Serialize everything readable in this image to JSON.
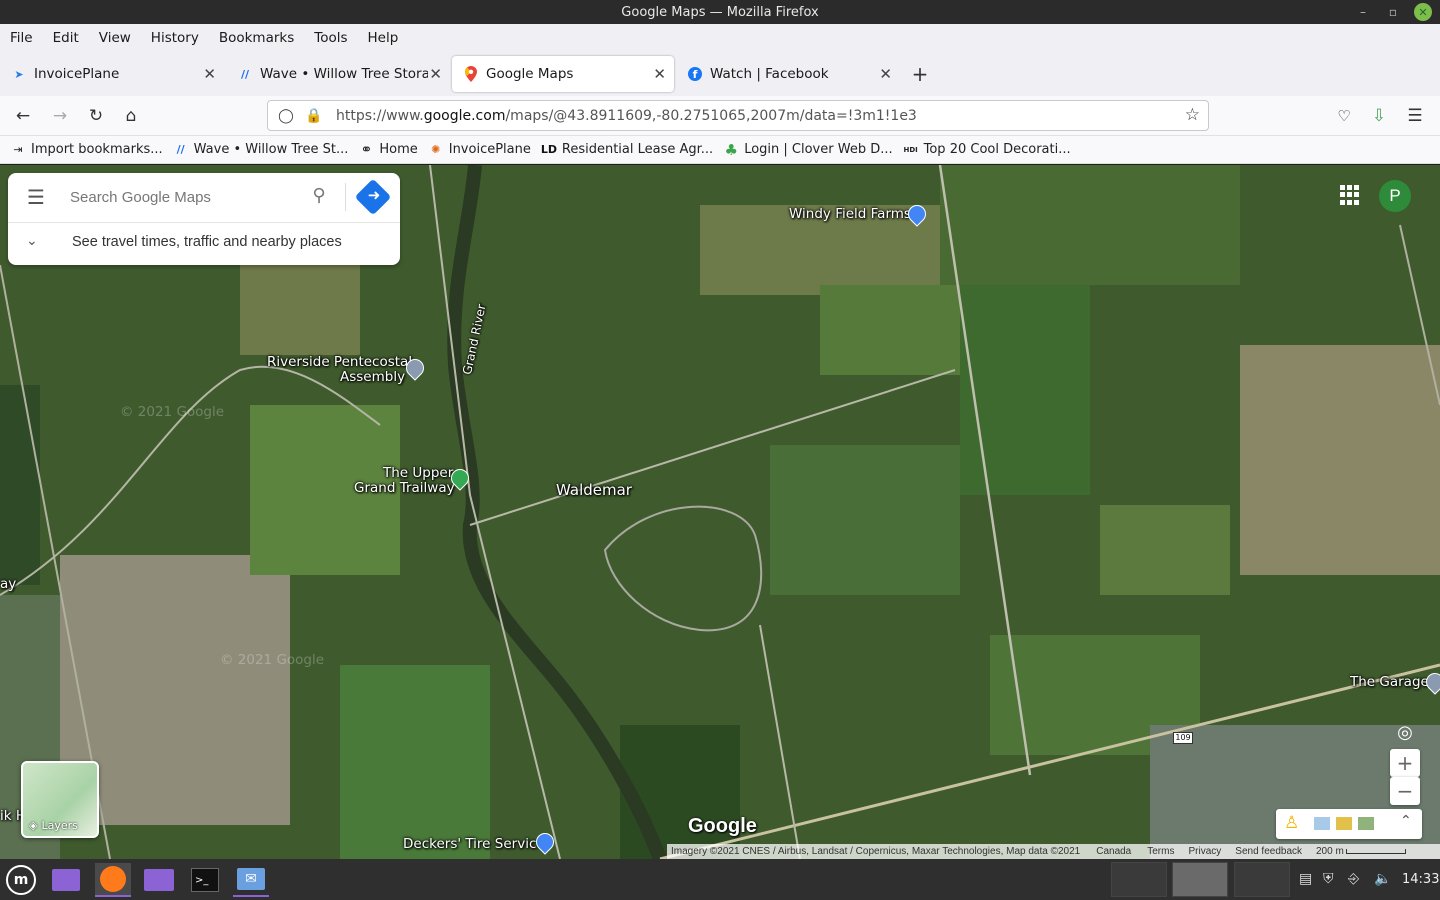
{
  "window": {
    "title": "Google Maps — Mozilla Firefox"
  },
  "menu": [
    "File",
    "Edit",
    "View",
    "History",
    "Bookmarks",
    "Tools",
    "Help"
  ],
  "tabs": [
    {
      "label": "InvoicePlane",
      "icon": "invoiceplane-icon"
    },
    {
      "label": "Wave • Willow Tree Storage",
      "icon": "wave-icon"
    },
    {
      "label": "Google Maps",
      "icon": "google-maps-icon",
      "active": true
    },
    {
      "label": "Watch | Facebook",
      "icon": "facebook-icon"
    }
  ],
  "url": {
    "scheme": "https://www.",
    "domain": "google.com",
    "path": "/maps/@43.8911609,-80.2751065,2007m/data=!3m1!1e3"
  },
  "bookmarks": [
    {
      "label": "Import bookmarks...",
      "icon": "import-icon"
    },
    {
      "label": "Wave • Willow Tree St...",
      "icon": "wave-icon"
    },
    {
      "label": "Home",
      "icon": "globe-icon"
    },
    {
      "label": "InvoicePlane",
      "icon": "invoiceplane-icon"
    },
    {
      "label": "Residential Lease Agr...",
      "icon": "ld-icon"
    },
    {
      "label": "Login | Clover Web D...",
      "icon": "clover-icon"
    },
    {
      "label": "Top 20 Cool Decorati...",
      "icon": "hdi-icon"
    }
  ],
  "search": {
    "placeholder": "Search Google Maps",
    "travel": "See travel times, traffic and nearby places"
  },
  "map": {
    "labels": {
      "windy": "Windy Field Farms",
      "grand_river": "Grand River",
      "riverside": "Riverside Pentecostal",
      "assembly": "Assembly",
      "upper": "The Upper",
      "trailway": "Grand Trailway",
      "waldemar": "Waldemar",
      "garage": "The Garage",
      "deckers": "Deckers' Tire Service",
      "ay": "ay",
      "ikh": "ik H",
      "route": "109",
      "watermark1": "© 2021 Google",
      "watermark2": "© 2021 Google"
    },
    "account_initial": "P",
    "layers_label": "Layers",
    "logo": "Google",
    "attribution": "Imagery ©2021 CNES / Airbus, Landsat / Copernicus, Maxar Technologies, Map data ©2021",
    "country": "Canada",
    "terms": "Terms",
    "privacy": "Privacy",
    "feedback": "Send feedback",
    "scale": "200 m"
  },
  "colors": {
    "accent": "#1a73e8",
    "avatar": "#2e8b3a",
    "pin_blue": "#4285f4",
    "pin_green": "#34a853",
    "pin_grey": "#8a9ab0"
  },
  "taskbar": {
    "clock": "14:33"
  }
}
